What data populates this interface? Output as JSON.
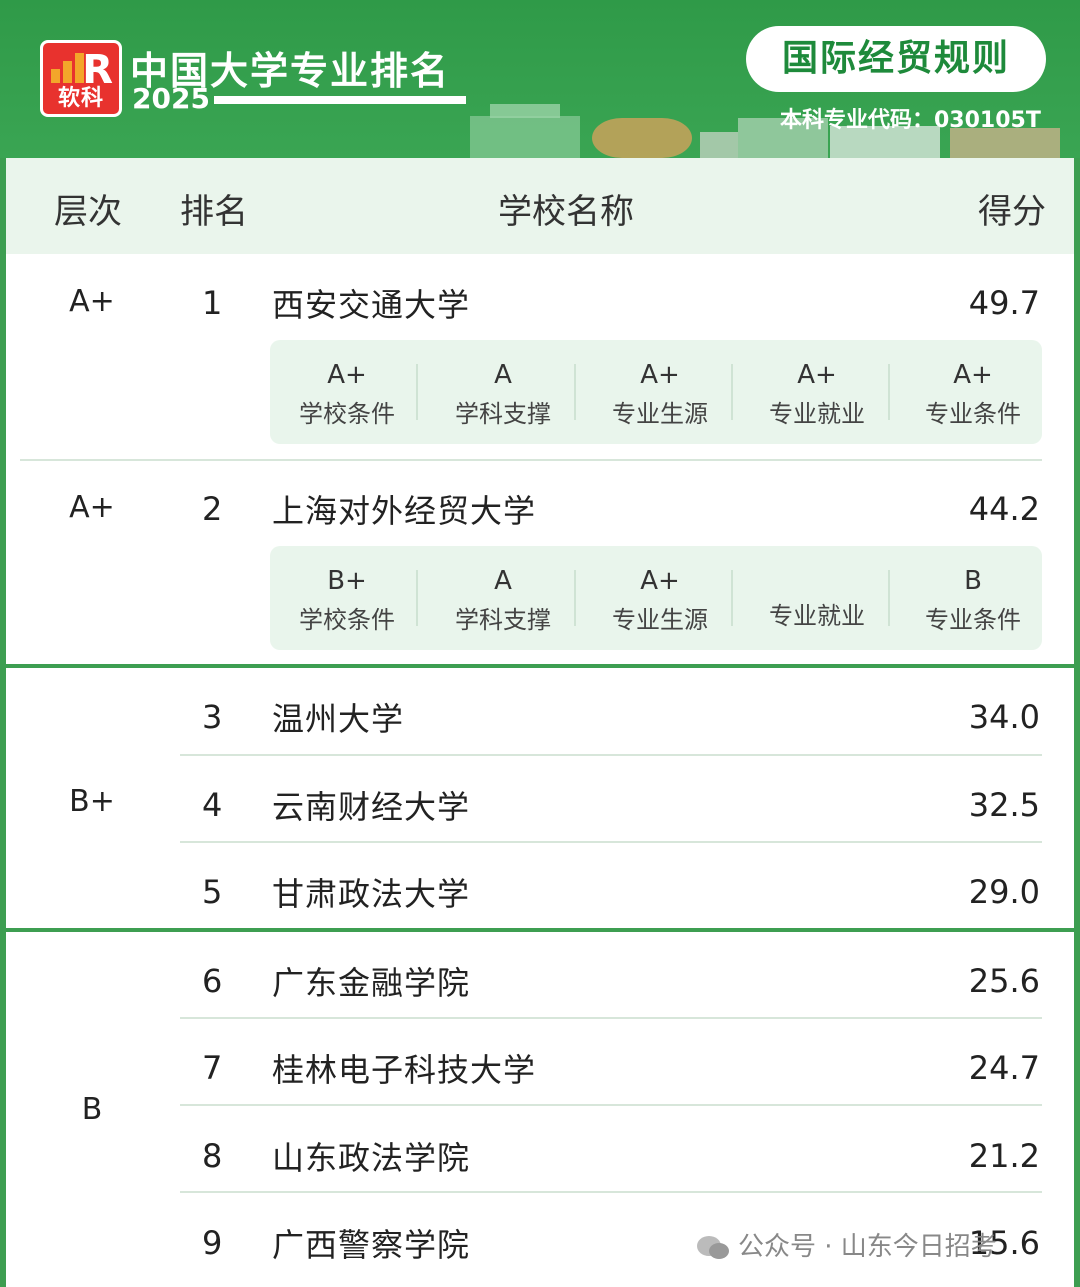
{
  "header": {
    "logo_text": "软科",
    "title": "中国大学专业排名",
    "year": "2025",
    "major": "国际经贸规则",
    "major_code": "本科专业代码：030105T"
  },
  "table": {
    "columns": [
      "层次",
      "排名",
      "学校名称",
      "得分"
    ],
    "rows": [
      {
        "level": "A+",
        "rank": "1",
        "name": "西安交通大学",
        "score": "49.7",
        "sub": [
          {
            "grade": "A+",
            "label": "学校条件"
          },
          {
            "grade": "A",
            "label": "学科支撑"
          },
          {
            "grade": "A+",
            "label": "专业生源"
          },
          {
            "grade": "A+",
            "label": "专业就业"
          },
          {
            "grade": "A+",
            "label": "专业条件"
          }
        ]
      },
      {
        "level": "A+",
        "rank": "2",
        "name": "上海对外经贸大学",
        "score": "44.2",
        "sub": [
          {
            "grade": "B+",
            "label": "学校条件"
          },
          {
            "grade": "A",
            "label": "学科支撑"
          },
          {
            "grade": "A+",
            "label": "专业生源"
          },
          {
            "grade": "",
            "label": "专业就业"
          },
          {
            "grade": "B",
            "label": "专业条件"
          }
        ]
      },
      {
        "rank": "3",
        "name": "温州大学",
        "score": "34.0"
      },
      {
        "rank": "4",
        "name": "云南财经大学",
        "score": "32.5"
      },
      {
        "rank": "5",
        "name": "甘肃政法大学",
        "score": "29.0"
      },
      {
        "rank": "6",
        "name": "广东金融学院",
        "score": "25.6"
      },
      {
        "rank": "7",
        "name": "桂林电子科技大学",
        "score": "24.7"
      },
      {
        "rank": "8",
        "name": "山东政法学院",
        "score": "21.2"
      },
      {
        "rank": "9",
        "name": "广西警察学院",
        "score": "15.6"
      }
    ],
    "group_levels": {
      "b_plus": "B+",
      "b": "B"
    }
  },
  "watermark": "公众号 · 山东今日招考",
  "colors": {
    "brand_green": "#3d9e51",
    "logo_red": "#e8322e",
    "header_bg": "#eaf5ec"
  }
}
